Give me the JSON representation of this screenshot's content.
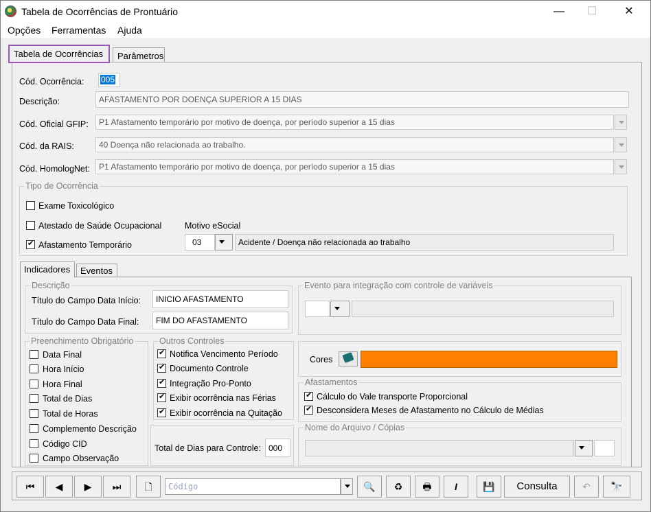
{
  "window": {
    "title": "Tabela de Ocorrências de Prontuário",
    "minimize": "—",
    "maximize": "☐",
    "close": "✕"
  },
  "menu": [
    "Opções",
    "Ferramentas",
    "Ajuda"
  ],
  "tabs": [
    "Tabela de Ocorrências",
    "Parâmetros"
  ],
  "form": {
    "cod_ocorrencia_label": "Cód. Ocorrência:",
    "cod_ocorrencia_value": "005",
    "descricao_label": "Descrição:",
    "descricao_value": "AFASTAMENTO POR DOENÇA SUPERIOR A 15 DIAS",
    "gfip_label": "Cód. Oficial GFIP:",
    "gfip_value": "P1 Afastamento temporário por motivo de doença, por período superior a 15 dias",
    "rais_label": "Cód. da RAIS:",
    "rais_value": "40 Doença não relacionada ao trabalho.",
    "homolognet_label": "Cód. HomologNet:",
    "homolognet_value": "P1  Afastamento temporário por motivo de doença, por período superior a 15 dias"
  },
  "tipo": {
    "title": "Tipo de Ocorrência",
    "exame": "Exame Toxicológico",
    "atestado": "Atestado de Saúde Ocupacional",
    "afastamento": "Afastamento Temporário",
    "motivo_label": "Motivo eSocial",
    "motivo_code": "03",
    "motivo_desc": "Acidente / Doença não relacionada ao trabalho"
  },
  "subtabs": [
    "Indicadores",
    "Eventos"
  ],
  "descricao_group": {
    "title": "Descrição",
    "inicio_label": "Título do Campo Data Início:",
    "inicio_value": "INICIO AFASTAMENTO",
    "final_label": "Título do Campo Data Final:",
    "final_value": "FIM DO AFASTAMENTO"
  },
  "evento_group": {
    "title": "Evento para integração com controle de variáveis"
  },
  "preenchimento": {
    "title": "Preenchimento Obrigatório",
    "items": [
      "Data Final",
      "Hora Início",
      "Hora Final",
      "Total de Dias",
      "Total de Horas",
      "Complemento Descrição",
      "Código CID",
      "Campo Observação"
    ]
  },
  "outros": {
    "title": "Outros Controles",
    "items": [
      "Notifica Vencimento Período",
      "Documento Controle",
      "Integração Pro-Ponto",
      "Exibir ocorrência nas Férias",
      "Exibir ocorrência na Quitação"
    ],
    "total_label": "Total de Dias para Controle:",
    "total_value": "000"
  },
  "cores": {
    "label": "Cores",
    "color": "#ff8000"
  },
  "afastamentos": {
    "title": "Afastamentos",
    "items": [
      "Cálculo do Vale transporte Proporcional",
      "Desconsidera Meses de Afastamento no Cálculo de Médias"
    ]
  },
  "arquivo": {
    "title": "Nome do Arquivo / Cópias"
  },
  "toolbar": {
    "codigo_placeholder": "Código",
    "consulta_label": "Consulta"
  }
}
